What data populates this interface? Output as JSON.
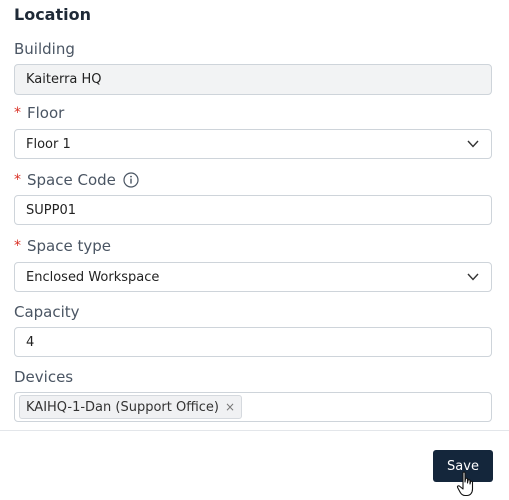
{
  "section_title": "Location",
  "building": {
    "label": "Building",
    "value": "Kaiterra HQ"
  },
  "floor": {
    "required_mark": "*",
    "label": "Floor",
    "value": "Floor 1"
  },
  "space_code": {
    "required_mark": "*",
    "label": "Space Code",
    "value": "SUPP01"
  },
  "space_type": {
    "required_mark": "*",
    "label": "Space type",
    "value": "Enclosed Workspace"
  },
  "capacity": {
    "label": "Capacity",
    "value": "4"
  },
  "devices": {
    "label": "Devices",
    "tags": [
      "KAIHQ-1-Dan (Support Office)"
    ],
    "remove_glyph": "×"
  },
  "footer": {
    "save_label": "Save"
  },
  "icons": {
    "floor_dropdown": "chevron-down-icon",
    "space_type_dropdown": "chevron-down-icon",
    "space_code_info": "info-icon",
    "cursor": "hand-pointer-icon"
  },
  "colors": {
    "primary_button": "#14263b",
    "required": "#d93025"
  }
}
